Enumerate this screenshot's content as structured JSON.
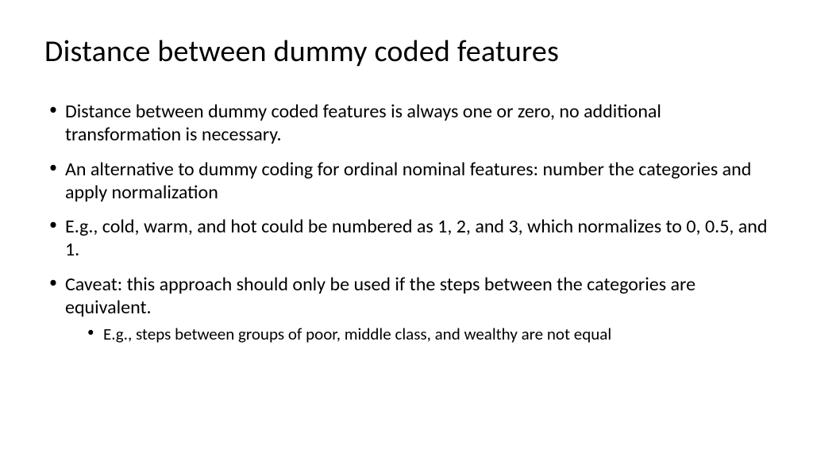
{
  "title": "Distance between dummy coded features",
  "bullets": [
    {
      "text": "Distance between dummy coded features is always one or zero, no additional transformation is necessary."
    },
    {
      "text": "An alternative to dummy coding for ordinal nominal features: number the categories and apply normalization"
    },
    {
      "text": "E.g., cold, warm, and hot could be numbered as 1, 2, and 3, which normalizes to 0, 0.5, and 1."
    },
    {
      "text": "Caveat: this approach should only be used if the steps between the categories are equivalent.",
      "sub": [
        {
          "text": "E.g., steps between groups of poor, middle class, and wealthy are not equal"
        }
      ]
    }
  ]
}
